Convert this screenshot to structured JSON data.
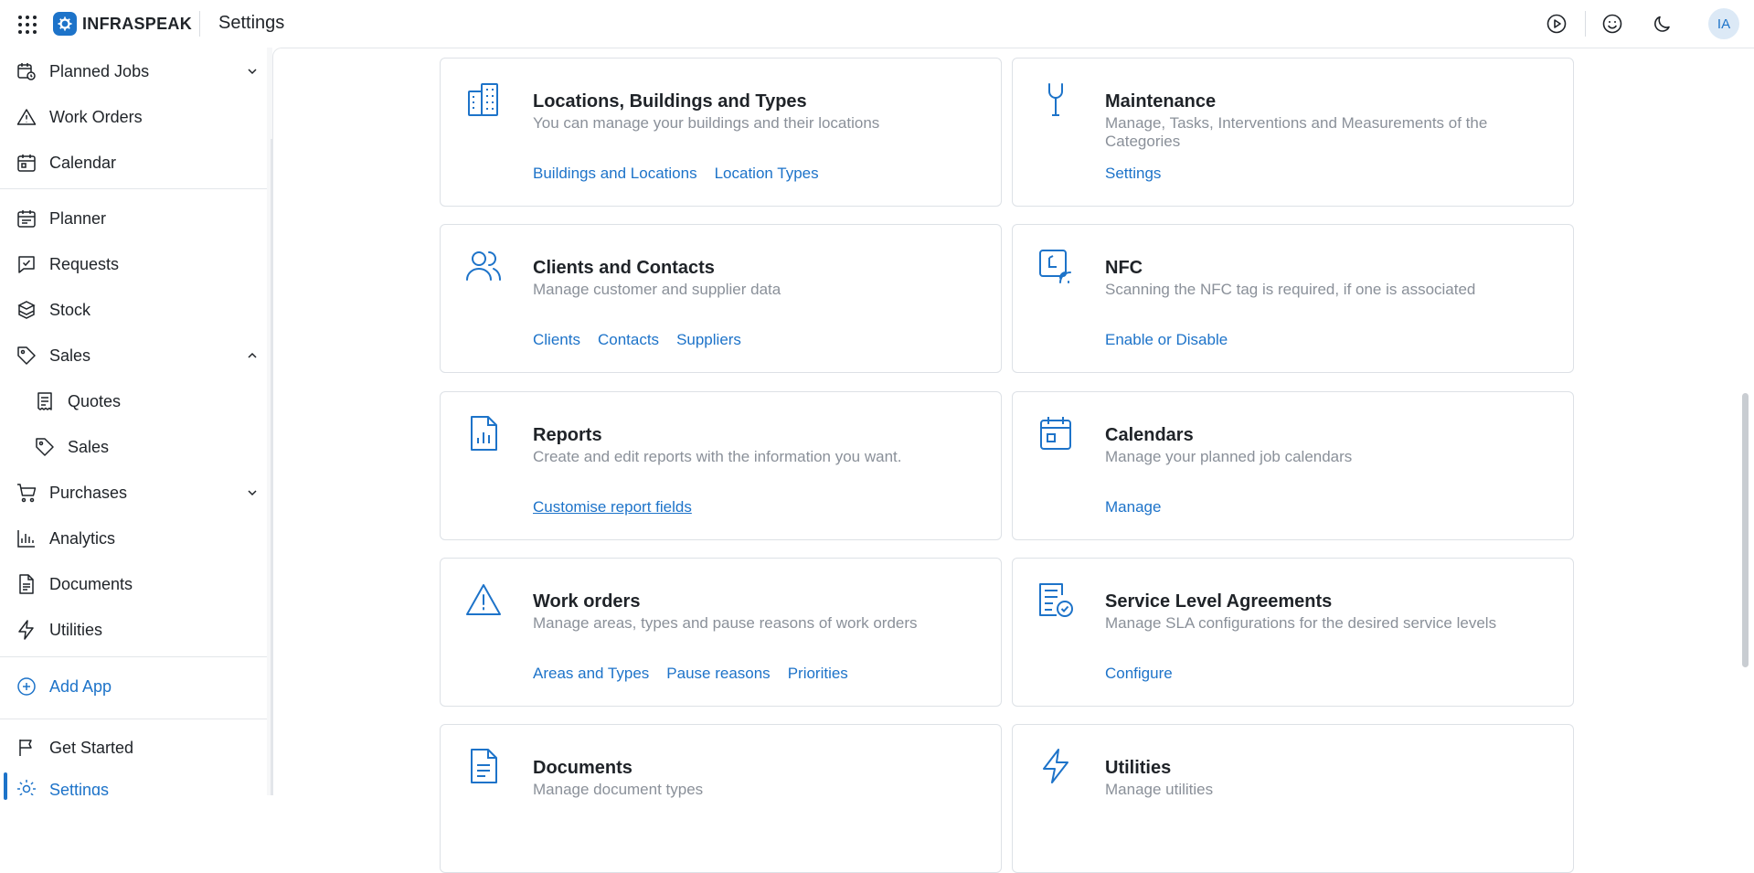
{
  "app": {
    "brand": "INFRASPEAK",
    "page_title": "Settings",
    "user_initials": "IA"
  },
  "colors": {
    "accent": "#1d73c9",
    "muted_text": "#8a9099",
    "border": "#dde1e6"
  },
  "sidebar": {
    "items": [
      {
        "label": "Planned Jobs",
        "icon": "calendar-clock-icon"
      },
      {
        "label": "Work Orders",
        "icon": "warning-triangle-icon"
      },
      {
        "label": "Calendar",
        "icon": "calendar-icon"
      },
      {
        "label": "Planner",
        "icon": "planner-icon"
      },
      {
        "label": "Requests",
        "icon": "message-check-icon"
      },
      {
        "label": "Stock",
        "icon": "boxes-icon"
      },
      {
        "label": "Sales",
        "icon": "tag-icon"
      },
      {
        "label": "Quotes",
        "icon": "receipt-icon"
      },
      {
        "label": "Sales",
        "icon": "tag-icon"
      },
      {
        "label": "Purchases",
        "icon": "cart-icon"
      },
      {
        "label": "Analytics",
        "icon": "bar-chart-icon"
      },
      {
        "label": "Documents",
        "icon": "document-icon"
      },
      {
        "label": "Utilities",
        "icon": "lightning-icon"
      },
      {
        "label": "Add App",
        "icon": "plus-circle-icon"
      },
      {
        "label": "Get Started",
        "icon": "flag-icon"
      },
      {
        "label": "Settings",
        "icon": "gear-icon"
      }
    ]
  },
  "cards": [
    {
      "title": "Locations, Buildings and Types",
      "desc": "You can manage your buildings and their locations",
      "links": [
        "Buildings and Locations",
        "Location Types"
      ],
      "icon": "buildings-icon"
    },
    {
      "title": "Maintenance",
      "desc": "Manage, Tasks, Interventions and Measurements of the Categories",
      "links": [
        "Settings"
      ],
      "icon": "wrench-icon"
    },
    {
      "title": "Clients and Contacts",
      "desc": "Manage customer and supplier data",
      "links": [
        "Clients",
        "Contacts",
        "Suppliers"
      ],
      "icon": "users-icon"
    },
    {
      "title": "NFC",
      "desc": "Scanning the NFC tag is required, if one is associated",
      "links": [
        "Enable or Disable"
      ],
      "icon": "nfc-icon"
    },
    {
      "title": "Reports",
      "desc": "Create and edit reports with the information you want.",
      "links": [
        "Customise report fields"
      ],
      "icon": "report-icon"
    },
    {
      "title": "Calendars",
      "desc": "Manage your planned job calendars",
      "links": [
        "Manage"
      ],
      "icon": "calendar-icon"
    },
    {
      "title": "Work orders",
      "desc": "Manage areas, types and pause reasons of work orders",
      "links": [
        "Areas and Types",
        "Pause reasons",
        "Priorities"
      ],
      "icon": "warning-triangle-icon"
    },
    {
      "title": "Service Level Agreements",
      "desc": "Manage SLA configurations for the desired service levels",
      "links": [
        "Configure"
      ],
      "icon": "sla-icon"
    },
    {
      "title": "Documents",
      "desc": "Manage document types",
      "links": [],
      "icon": "document-icon"
    },
    {
      "title": "Utilities",
      "desc": "Manage utilities",
      "links": [],
      "icon": "lightning-icon"
    }
  ]
}
